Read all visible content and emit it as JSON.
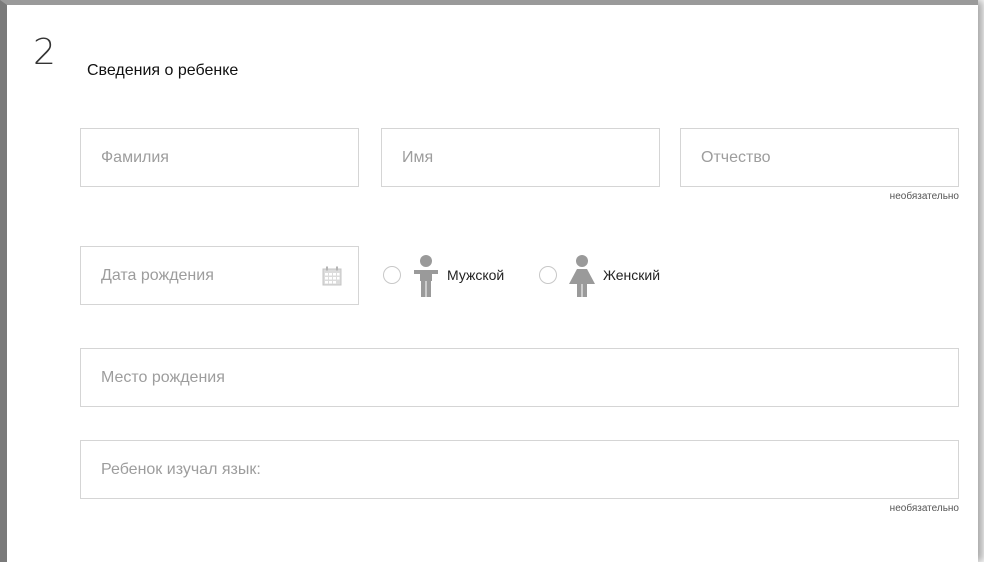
{
  "section": {
    "number": "2",
    "title": "Сведения о ребенке"
  },
  "fields": {
    "surname": {
      "placeholder": "Фамилия",
      "value": ""
    },
    "name": {
      "placeholder": "Имя",
      "value": ""
    },
    "patronymic": {
      "placeholder": "Отчество",
      "value": "",
      "note": "необязательно"
    },
    "birth_date": {
      "placeholder": "Дата рождения",
      "value": ""
    },
    "birth_place": {
      "placeholder": "Место рождения",
      "value": ""
    },
    "language": {
      "placeholder": "Ребенок изучал язык:",
      "value": "",
      "note": "необязательно"
    }
  },
  "gender": {
    "options": [
      {
        "label": "Мужской",
        "icon": "male-child-icon",
        "selected": false
      },
      {
        "label": "Женский",
        "icon": "female-child-icon",
        "selected": false
      }
    ]
  },
  "colors": {
    "border": "#d5d5d5",
    "placeholder": "#9d9d9d",
    "icon": "#9a9a9a"
  }
}
